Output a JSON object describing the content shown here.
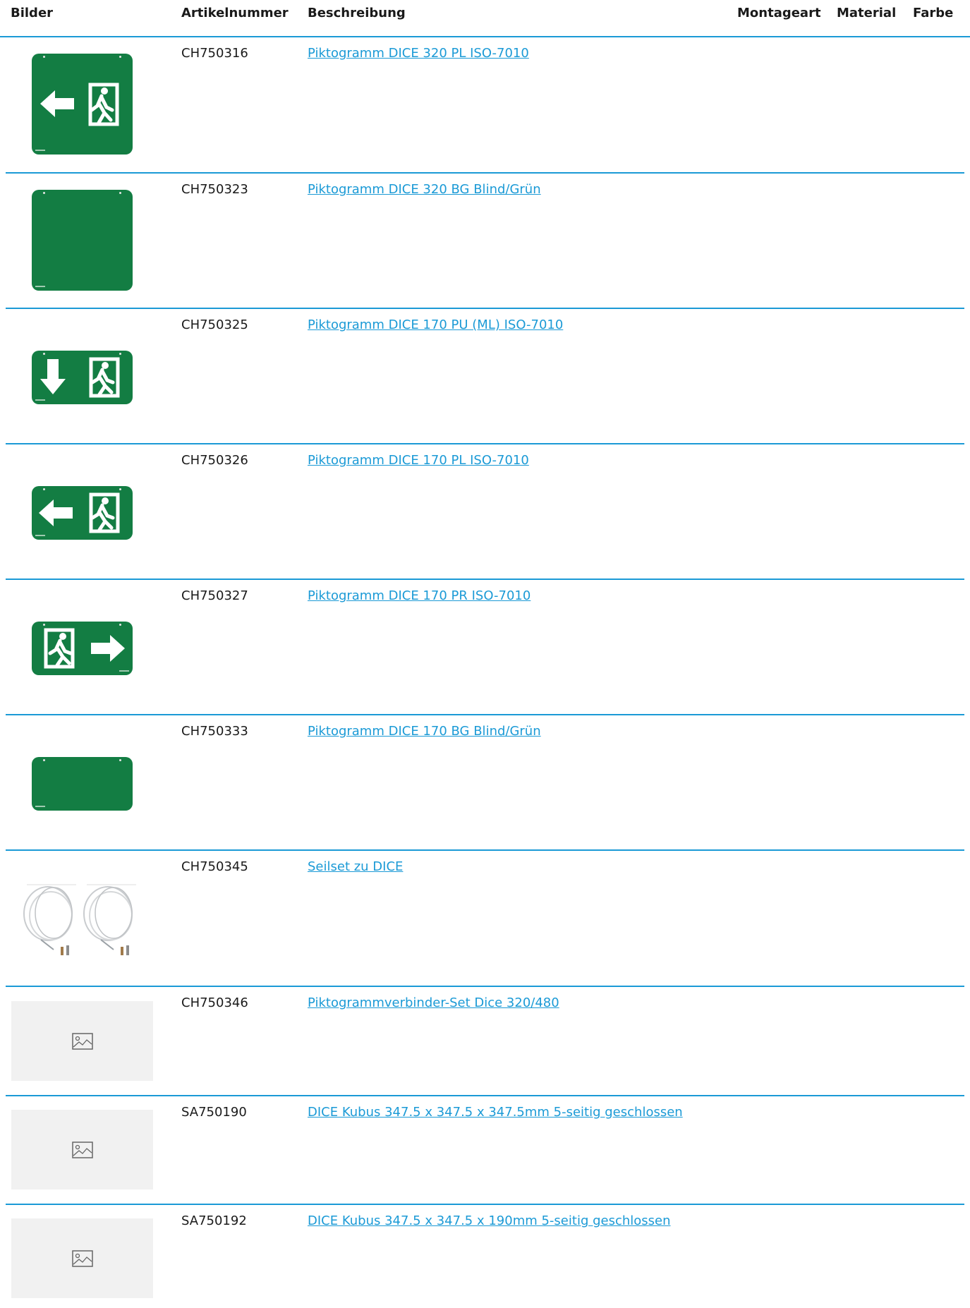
{
  "table": {
    "headers": {
      "bilder": "Bilder",
      "artikelnummer": "Artikelnummer",
      "beschreibung": "Beschreibung",
      "montageart": "Montageart",
      "material": "Material",
      "farbe": "Farbe"
    },
    "rows": [
      {
        "artikelnummer": "CH750316",
        "beschreibung": "Piktogramm DICE 320 PL ISO-7010",
        "image": "exit-sign-arrow-left-square"
      },
      {
        "artikelnummer": "CH750323",
        "beschreibung": "Piktogramm DICE 320 BG Blind/Grün",
        "image": "blank-green-square"
      },
      {
        "artikelnummer": "CH750325",
        "beschreibung": "Piktogramm DICE 170 PU (ML) ISO-7010",
        "image": "exit-sign-arrow-down"
      },
      {
        "artikelnummer": "CH750326",
        "beschreibung": "Piktogramm DICE 170 PL ISO-7010",
        "image": "exit-sign-arrow-left"
      },
      {
        "artikelnummer": "CH750327",
        "beschreibung": "Piktogramm DICE 170 PR ISO-7010",
        "image": "exit-sign-arrow-right"
      },
      {
        "artikelnummer": "CH750333",
        "beschreibung": "Piktogramm DICE 170 BG Blind/Grün",
        "image": "blank-green-rectangle"
      },
      {
        "artikelnummer": "CH750345",
        "beschreibung": "Seilset zu DICE",
        "image": "cable-set-photo"
      },
      {
        "artikelnummer": "CH750346",
        "beschreibung": "Piktogrammverbinder-Set Dice 320/480",
        "image": "image-placeholder-icon"
      },
      {
        "artikelnummer": "SA750190",
        "beschreibung": "DICE Kubus 347.5 x 347.5 x 347.5mm 5-seitig geschlossen",
        "image": "image-placeholder-icon"
      },
      {
        "artikelnummer": "SA750192",
        "beschreibung": "DICE Kubus 347.5 x 347.5 x 190mm 5-seitig geschlossen",
        "image": "image-placeholder-icon"
      }
    ]
  },
  "colors": {
    "accent_line": "#1b9ad6",
    "link": "#1b9ad6",
    "sign_green": "#137d43",
    "placeholder_bg": "#f1f1f1"
  }
}
